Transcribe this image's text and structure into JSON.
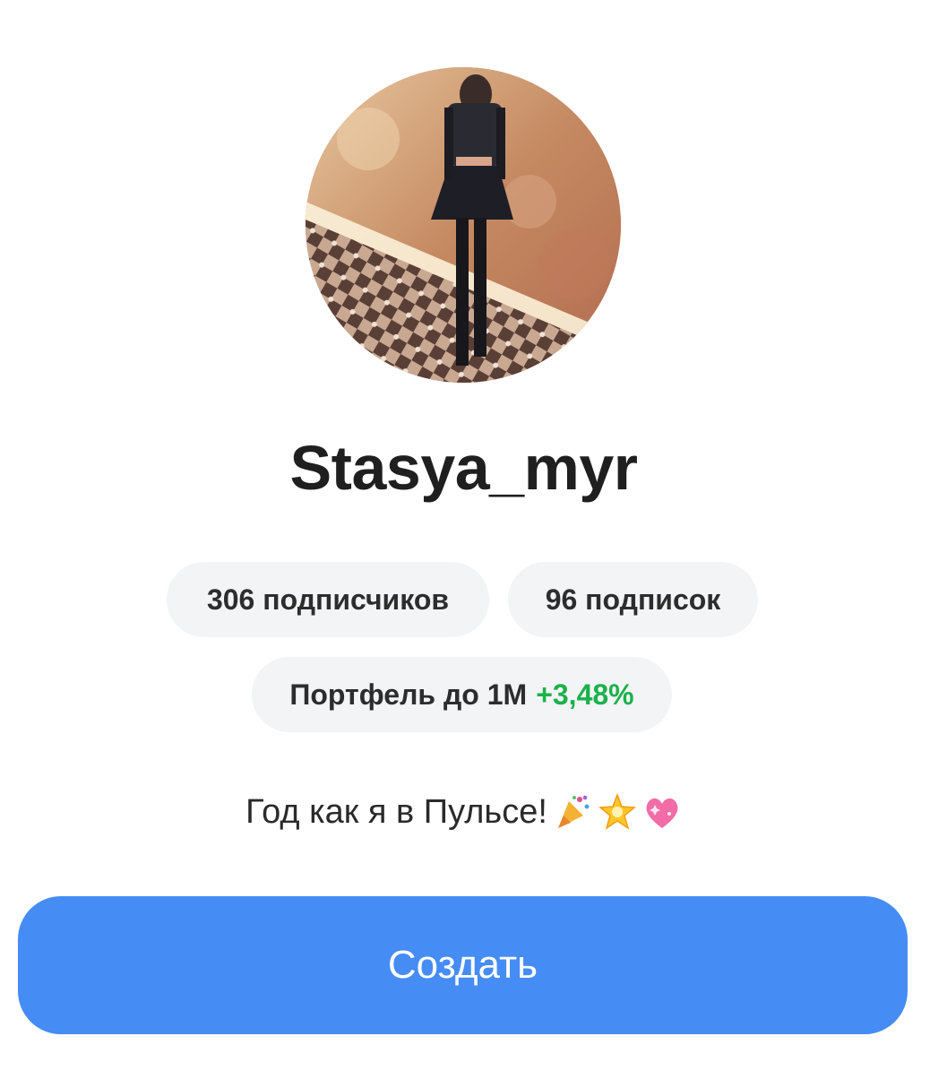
{
  "profile": {
    "avatar_alt": "profile-photo",
    "username": "Stasya_myr",
    "followers_label": "306 подписчиков",
    "following_label": "96 подписок",
    "portfolio": {
      "label": "Портфель до 1М",
      "change": "+3,48%",
      "change_color": "#1ab24a"
    },
    "bio": {
      "text": "Год как я в Пульсе!",
      "emojis": [
        "party-popper-icon",
        "glowing-star-icon",
        "sparkling-heart-icon"
      ]
    }
  },
  "actions": {
    "create_label": "Создать"
  },
  "colors": {
    "accent": "#468cf5",
    "pill_bg": "#f3f4f6",
    "gain": "#1ab24a"
  }
}
